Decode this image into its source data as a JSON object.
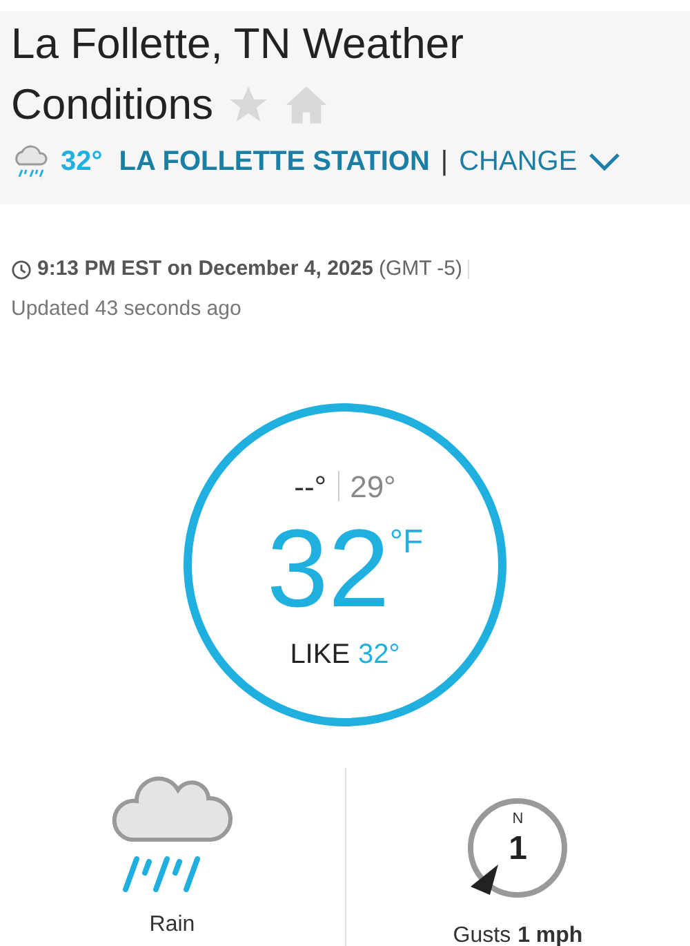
{
  "header": {
    "title": "La Follette, TN Weather Conditions",
    "station_temp": "32°",
    "station": "LA FOLLETTE STATION",
    "separator": "|",
    "change": "CHANGE"
  },
  "time": {
    "datetime": "9:13 PM EST on December 4, 2025",
    "zone": "(GMT -5)",
    "updated": "Updated 43 seconds ago"
  },
  "current": {
    "high": "--°",
    "low": "29°",
    "temp": "32",
    "unit": "°F",
    "like_label": "LIKE",
    "like": "32°"
  },
  "condition": {
    "label": "Rain"
  },
  "wind": {
    "direction": "N",
    "speed": "1",
    "gusts_label": "Gusts",
    "gusts": "1 mph"
  }
}
